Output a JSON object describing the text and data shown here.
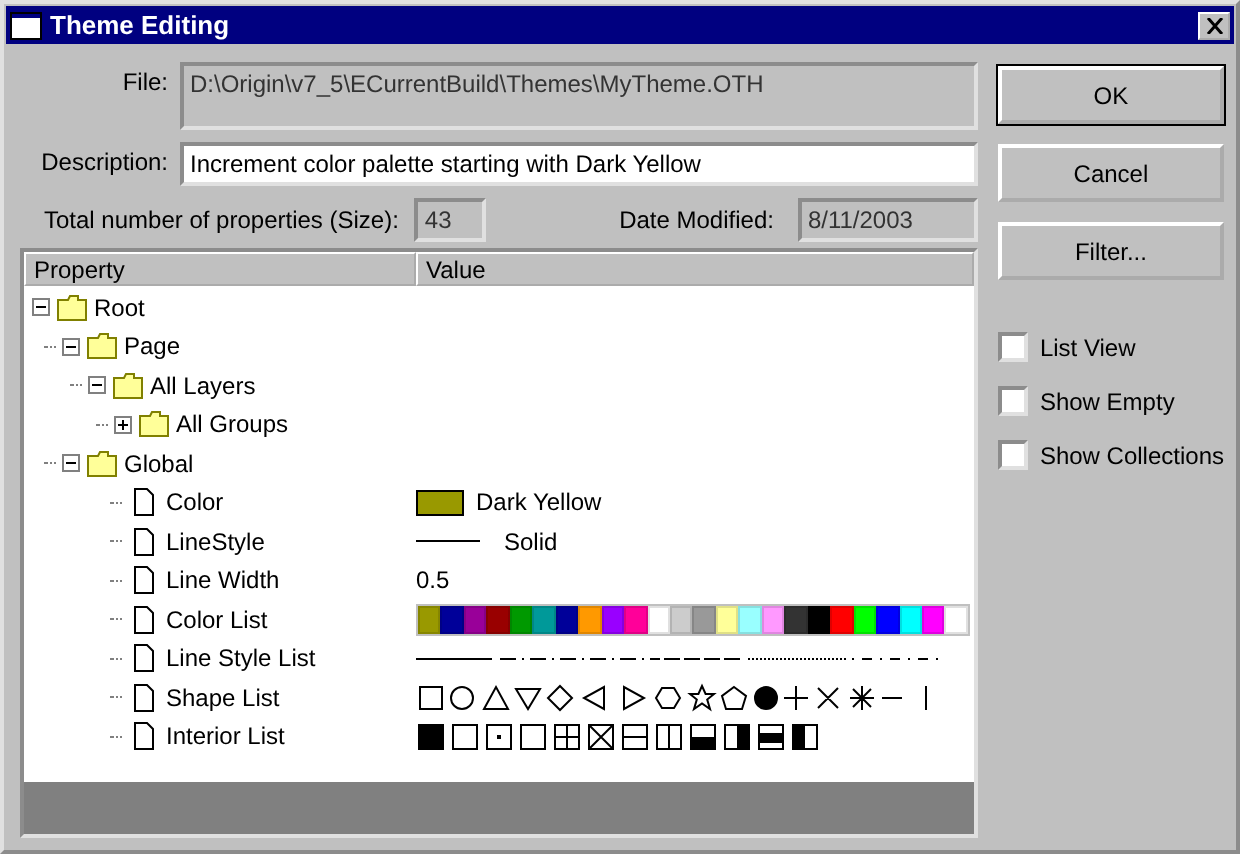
{
  "window": {
    "title": "Theme Editing"
  },
  "file": {
    "label": "File:",
    "value": "D:\\Origin\\v7_5\\ECurrentBuild\\Themes\\MyTheme.OTH"
  },
  "description": {
    "label": "Description:",
    "value": "Increment color palette starting with Dark Yellow"
  },
  "size": {
    "label": "Total number of properties (Size):",
    "value": "43"
  },
  "date_modified": {
    "label": "Date Modified:",
    "value": "8/11/2003"
  },
  "buttons": [
    "OK",
    "Cancel",
    "Filter..."
  ],
  "checkboxes": [
    {
      "label": "List View",
      "checked": false
    },
    {
      "label": "Show Empty",
      "checked": false
    },
    {
      "label": "Show Collections",
      "checked": false
    }
  ],
  "tree": {
    "columns": [
      "Property",
      "Value"
    ],
    "items": [
      {
        "label": "Root",
        "kind": "folder",
        "expanded": true,
        "children": [
          {
            "label": "Page",
            "kind": "folder",
            "expanded": true,
            "children": [
              {
                "label": "All Layers",
                "kind": "folder",
                "expanded": true,
                "children": [
                  {
                    "label": "All Groups",
                    "kind": "folder",
                    "expanded": false
                  }
                ]
              }
            ]
          },
          {
            "label": "Global",
            "kind": "folder",
            "expanded": true,
            "children": [
              {
                "label": "Color",
                "kind": "leaf",
                "value": {
                  "kind": "color",
                  "color": "#999900",
                  "text": "Dark Yellow"
                }
              },
              {
                "label": "LineStyle",
                "kind": "leaf",
                "value": {
                  "kind": "line",
                  "text": "Solid"
                }
              },
              {
                "label": "Line Width",
                "kind": "leaf",
                "value": {
                  "kind": "text",
                  "text": "0.5"
                }
              },
              {
                "label": "Color List",
                "kind": "leaf",
                "value": {
                  "kind": "palette",
                  "colors": [
                    {
                      "color": "#999900"
                    },
                    {
                      "color": "#000099"
                    },
                    {
                      "color": "#990099"
                    },
                    {
                      "color": "#990000"
                    },
                    {
                      "color": "#009900"
                    },
                    {
                      "color": "#009999"
                    },
                    {
                      "color": "#000099"
                    },
                    {
                      "color": "#ff9900"
                    },
                    {
                      "color": "#9900ff"
                    },
                    {
                      "color": "#ff0099"
                    },
                    {
                      "color": "#ffffff"
                    },
                    {
                      "color": "#cccccc"
                    },
                    {
                      "color": "#999999"
                    },
                    {
                      "color": "#ffff99"
                    },
                    {
                      "color": "#99ffff"
                    },
                    {
                      "color": "#ff99ff"
                    },
                    {
                      "color": "#333333"
                    },
                    {
                      "color": "#000000"
                    },
                    {
                      "color": "#ff0000"
                    },
                    {
                      "color": "#00ff00"
                    },
                    {
                      "color": "#0000ff"
                    },
                    {
                      "color": "#00ffff"
                    },
                    {
                      "color": "#ff00ff"
                    },
                    {
                      "color": "#ffffff"
                    }
                  ]
                }
              },
              {
                "label": "Line Style List",
                "kind": "leaf",
                "value": {
                  "kind": "line_styles"
                }
              },
              {
                "label": "Shape List",
                "kind": "leaf",
                "value": {
                  "kind": "shapes"
                }
              },
              {
                "label": "Interior List",
                "kind": "leaf",
                "value": {
                  "kind": "interiors"
                }
              }
            ]
          }
        ]
      }
    ]
  }
}
